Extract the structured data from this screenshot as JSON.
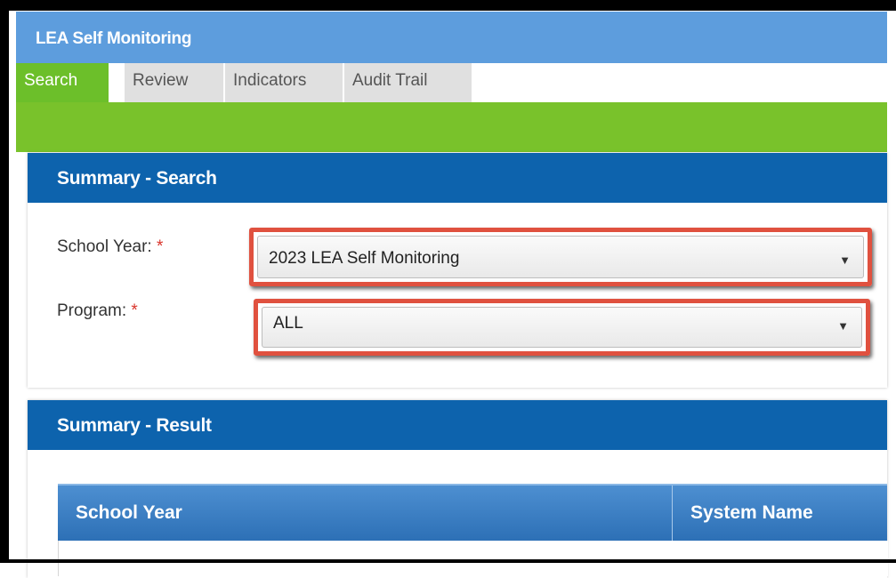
{
  "app": {
    "title": "LEA Self Monitoring"
  },
  "tabs": [
    {
      "label": "Search",
      "active": true
    },
    {
      "label": "Review",
      "active": false
    },
    {
      "label": "Indicators",
      "active": false
    },
    {
      "label": "Audit Trail",
      "active": false
    }
  ],
  "search_panel": {
    "title": "Summary - Search",
    "school_year": {
      "label": "School Year:",
      "required_mark": "*",
      "value": "2023 LEA Self Monitoring"
    },
    "program": {
      "label": "Program:",
      "required_mark": "*",
      "value": "ALL"
    }
  },
  "result_panel": {
    "title": "Summary - Result",
    "columns": [
      "School Year",
      "System Name"
    ]
  },
  "icons": {
    "dropdown": "triangle-down-icon"
  },
  "colors": {
    "header_blue": "#5d9ddd",
    "tab_green": "#79c22b",
    "panel_head_blue": "#0d63ad",
    "highlight_red": "#e0513f"
  }
}
